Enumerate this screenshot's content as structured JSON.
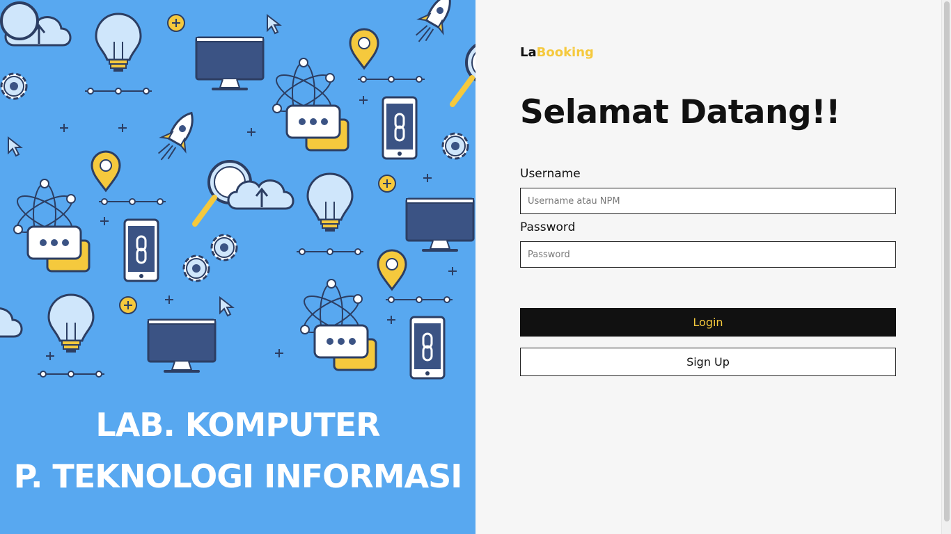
{
  "hero": {
    "line1": "LAB. KOMPUTER",
    "line2": "P. TEKNOLOGI INFORMASI",
    "background_color": "#58a8f0"
  },
  "brand": {
    "prefix": "La",
    "suffix": "Booking",
    "accent_color": "#f5c93d"
  },
  "welcome": "Selamat Datang!!",
  "form": {
    "username_label": "Username",
    "username_placeholder": "Username atau NPM",
    "username_value": "",
    "password_label": "Password",
    "password_placeholder": "Password",
    "password_value": ""
  },
  "buttons": {
    "login": "Login",
    "signup": "Sign Up"
  },
  "illustration_icons": [
    "lightbulb-icon",
    "monitor-icon",
    "rocket-icon",
    "map-pin-icon",
    "smartphone-link-icon",
    "chat-bubble-icon",
    "atom-icon",
    "gear-icon",
    "magnifier-icon",
    "cloud-upload-icon",
    "cursor-icon",
    "plus-icon"
  ]
}
